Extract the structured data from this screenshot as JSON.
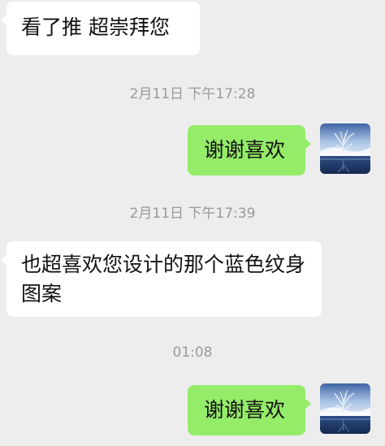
{
  "messages": [
    {
      "side": "in",
      "text": "看了推 超崇拜您"
    },
    {
      "timestamp": "2月11日 下午17:28"
    },
    {
      "side": "out",
      "text": "谢谢喜欢"
    },
    {
      "timestamp": "2月11日 下午17:39"
    },
    {
      "side": "in",
      "text": "也超喜欢您设计的那个蓝色纹身图案"
    },
    {
      "timestamp": "01:08"
    },
    {
      "side": "out",
      "text": "谢谢喜欢"
    }
  ],
  "avatar": {
    "icon": "winter-tree-lake-avatar-icon"
  },
  "colors": {
    "background": "#ededed",
    "incoming_bubble": "#ffffff",
    "outgoing_bubble": "#95ec69",
    "timestamp_text": "#9a9a9a"
  }
}
